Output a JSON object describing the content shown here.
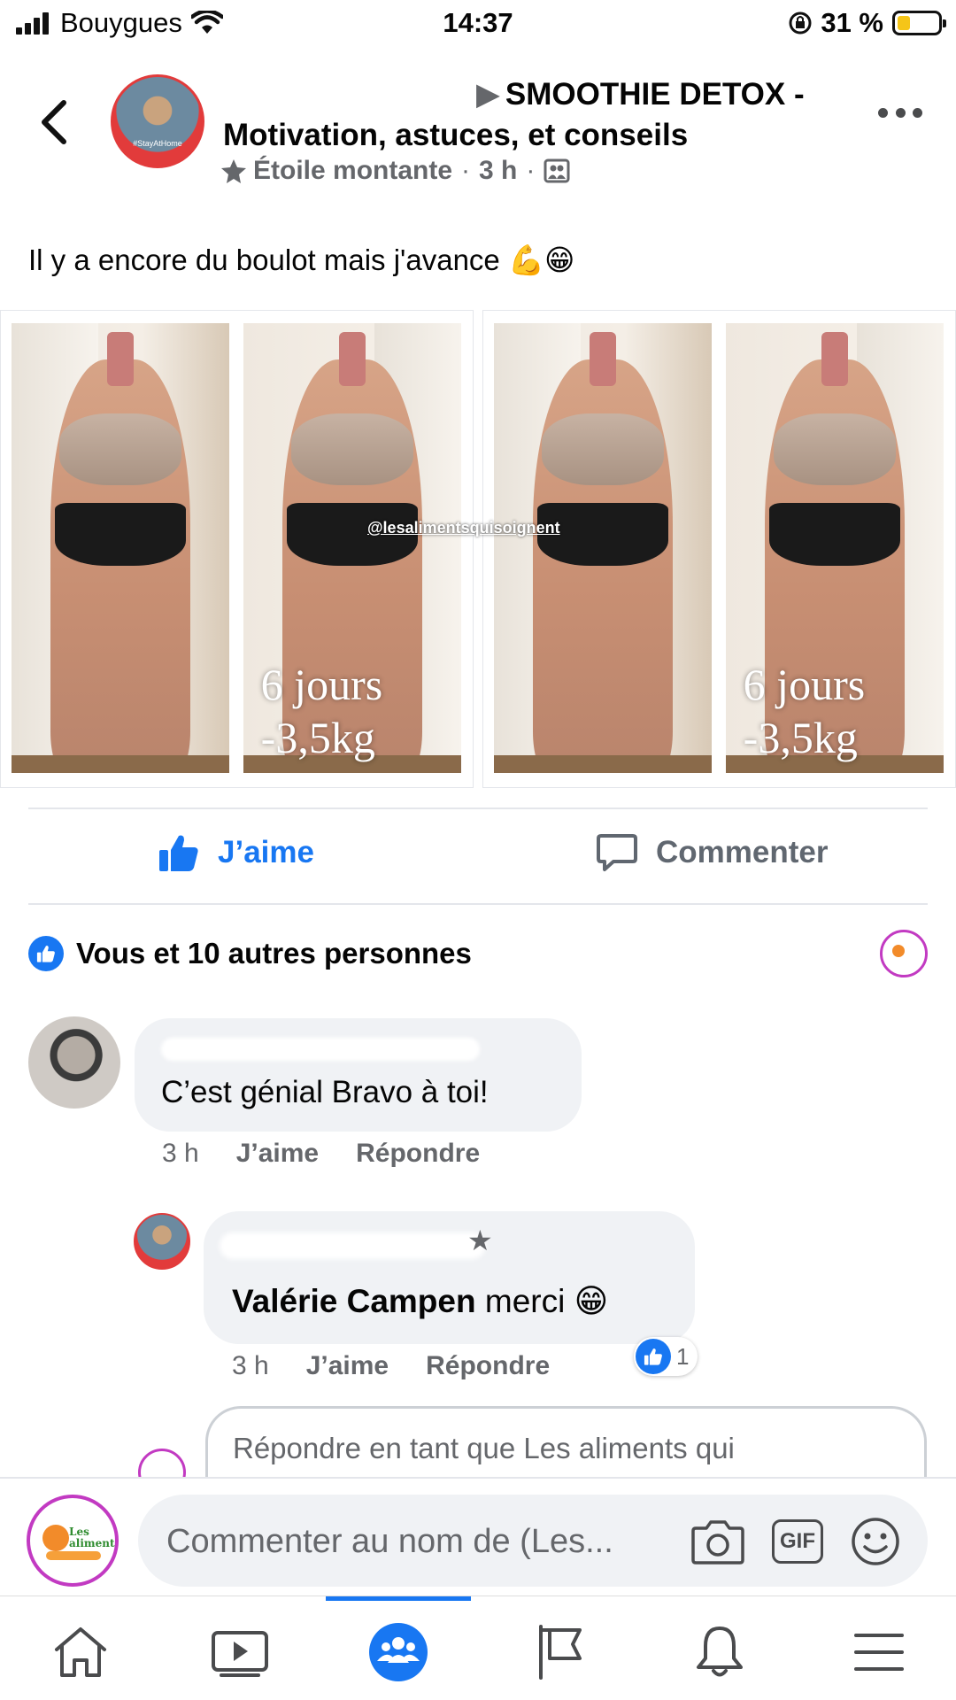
{
  "status_bar": {
    "carrier": "Bouygues",
    "time": "14:37",
    "battery_percent": "31 %",
    "battery_level": 0.31
  },
  "post": {
    "group_title": "SMOOTHIE DETOX - Motivation, astuces, et conseils",
    "badge": "Étoile montante",
    "time": "3 h",
    "text": "Il y a encore du boulot mais j'avance",
    "text_emojis": "💪😁",
    "photo_captions": [
      {
        "line1": "6 jours",
        "line2": "-3,5kg"
      },
      {
        "line1": "6 jours",
        "line2": "-3,5kg"
      }
    ],
    "watermark": "@lesalimentsquisoignent",
    "avatar_tag": "#StayAtHome"
  },
  "actions": {
    "like": "J’aime",
    "comment": "Commenter"
  },
  "reactions": {
    "summary": "Vous et 10 autres personnes"
  },
  "comments": [
    {
      "text": "C’est génial Bravo à toi!",
      "time": "3 h",
      "like": "J’aime",
      "reply": "Répondre"
    }
  ],
  "reply": {
    "mention": "Valérie Campen",
    "text": "merci",
    "emoji": "😁",
    "time": "3 h",
    "like": "J’aime",
    "reply": "Répondre",
    "like_count": "1"
  },
  "reply_input": {
    "placeholder": "Répondre en tant que Les aliments qui"
  },
  "comment_bar": {
    "placeholder": "Commenter au nom de (Les...",
    "gif": "GIF",
    "page_logo_text": "Les aliments qui soignent"
  },
  "tabs": [
    "home",
    "watch",
    "groups",
    "pages",
    "notifications",
    "menu"
  ],
  "colors": {
    "accent": "#1877f2",
    "text_secondary": "#65676b",
    "bubble": "#f0f2f5"
  }
}
